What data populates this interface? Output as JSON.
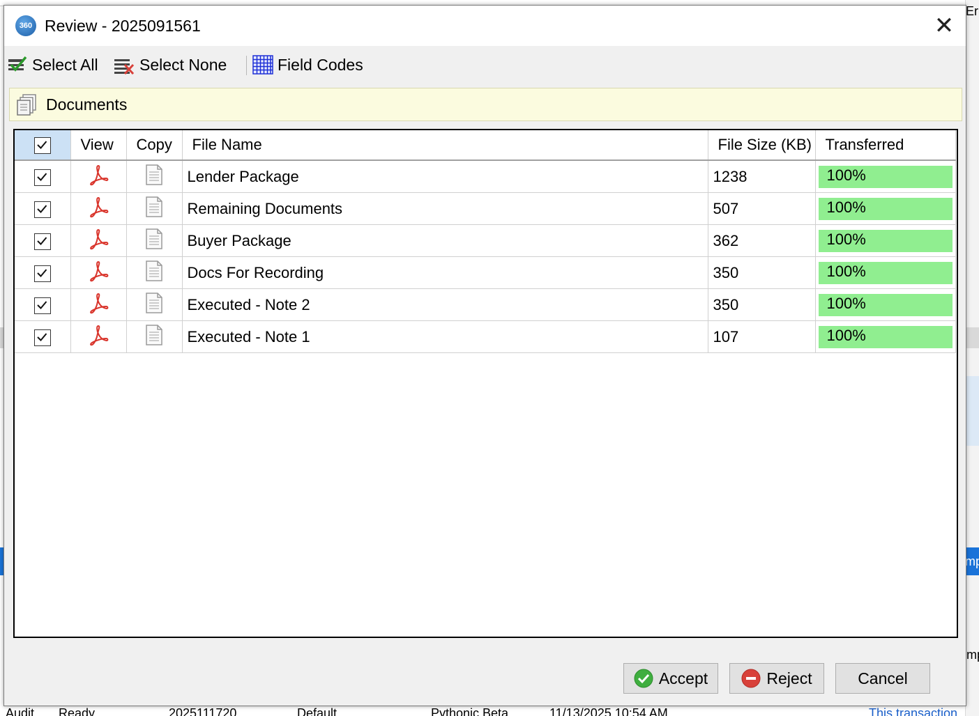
{
  "background": {
    "right_text_top": "Er",
    "right_text_selected": "mp",
    "right_text_lower": "mp",
    "bottom_row": [
      "Audit",
      "Ready",
      "2025111720",
      "Default",
      "Pythonic Beta",
      "11/13/2025 10:54 AM",
      "This transaction"
    ]
  },
  "dialog": {
    "icon_label": "360",
    "title": "Review - 2025091561",
    "close_glyph": "✕"
  },
  "toolbar": {
    "select_all": "Select All",
    "select_none": "Select None",
    "field_codes": "Field Codes"
  },
  "section": {
    "title": "Documents"
  },
  "grid": {
    "columns": {
      "view": "View",
      "copy": "Copy",
      "file_name": "File Name",
      "file_size": "File Size (KB)",
      "transferred": "Transferred"
    },
    "rows": [
      {
        "checked": true,
        "file_name": "Lender Package",
        "file_size": "1238",
        "transferred": "100%",
        "progress": 1.0
      },
      {
        "checked": true,
        "file_name": "Remaining Documents",
        "file_size": "507",
        "transferred": "100%",
        "progress": 1.0
      },
      {
        "checked": true,
        "file_name": "Buyer Package",
        "file_size": "362",
        "transferred": "100%",
        "progress": 1.0
      },
      {
        "checked": true,
        "file_name": "Docs For Recording",
        "file_size": "350",
        "transferred": "100%",
        "progress": 1.0
      },
      {
        "checked": true,
        "file_name": "Executed - Note 2",
        "file_size": "350",
        "transferred": "100%",
        "progress": 1.0
      },
      {
        "checked": true,
        "file_name": "Executed - Note 1",
        "file_size": "107",
        "transferred": "100%",
        "progress": 1.0
      }
    ]
  },
  "footer": {
    "accept": "Accept",
    "reject": "Reject",
    "cancel": "Cancel"
  },
  "colors": {
    "progress_fill": "#90ee90",
    "header_checkbox_bg": "#cce1f5",
    "section_bg": "#fbfbdf",
    "pdf_red": "#d9342b",
    "accept_green": "#3fae3f",
    "reject_red": "#d8413a"
  }
}
